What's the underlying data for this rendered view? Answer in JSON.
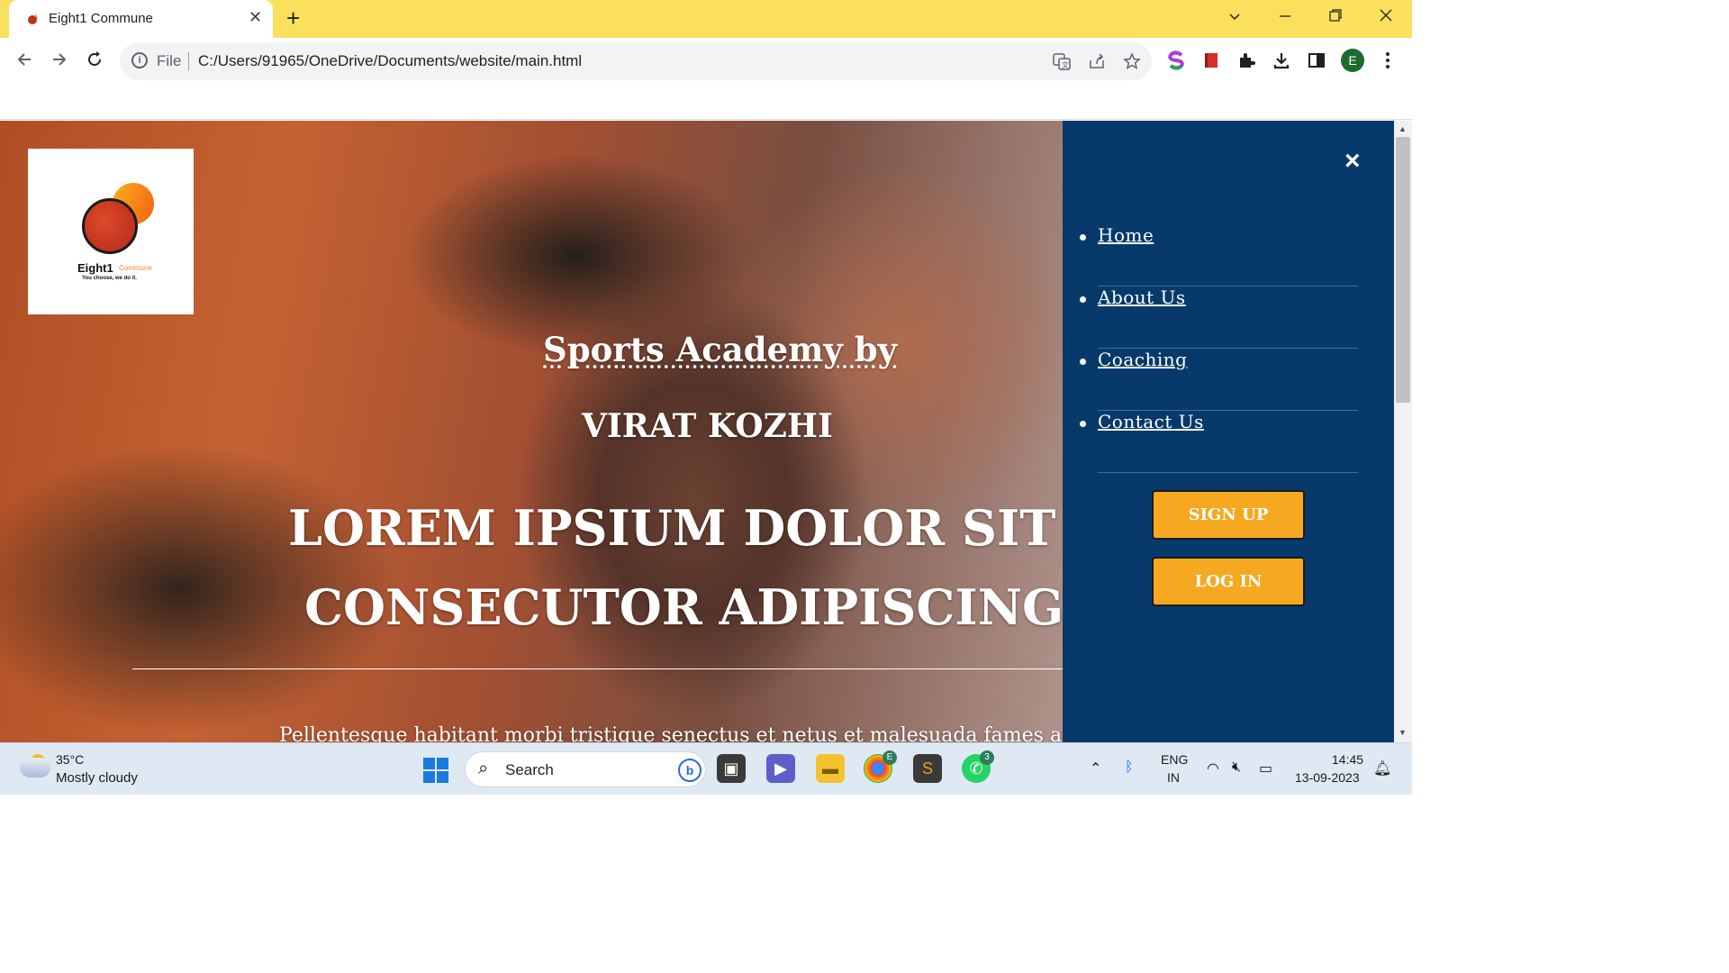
{
  "browser": {
    "tab_title": "Eight1 Commune",
    "tab_close": "✕",
    "new_tab": "+",
    "scheme": "File",
    "url": "C:/Users/91965/OneDrive/Documents/website/main.html",
    "profile_initial": "E"
  },
  "logo": {
    "name": "Eight1",
    "name_suffix": "Commune",
    "tagline": "You choose, we do it."
  },
  "hero": {
    "subtitle_1": "Sports Academy by",
    "subtitle_2": "VIRAT KOZHI",
    "headline_1": "LOREM IPSIUM DOLOR SIT AME",
    "headline_2": "CONSECUTOR ADIPISCING ELIT",
    "paragraph": "Pellentesque habitant morbi tristique senectus et netus et malesuada fames ac t"
  },
  "sidenav": {
    "close": "×",
    "items": [
      {
        "label": "Home"
      },
      {
        "label": "About Us"
      },
      {
        "label": "Coaching"
      },
      {
        "label": "Contact Us"
      }
    ],
    "signup_label": "SIGN UP",
    "login_label": "LOG IN",
    "colors": {
      "background": "#073a6b",
      "button": "#f7a821"
    }
  },
  "taskbar": {
    "temperature": "35°C",
    "condition": "Mostly cloudy",
    "search_placeholder": "Search",
    "chrome_badge": "E",
    "whatsapp_badge": "3",
    "lang_line1": "ENG",
    "lang_line2": "IN",
    "time": "14:45",
    "date": "13-09-2023"
  }
}
